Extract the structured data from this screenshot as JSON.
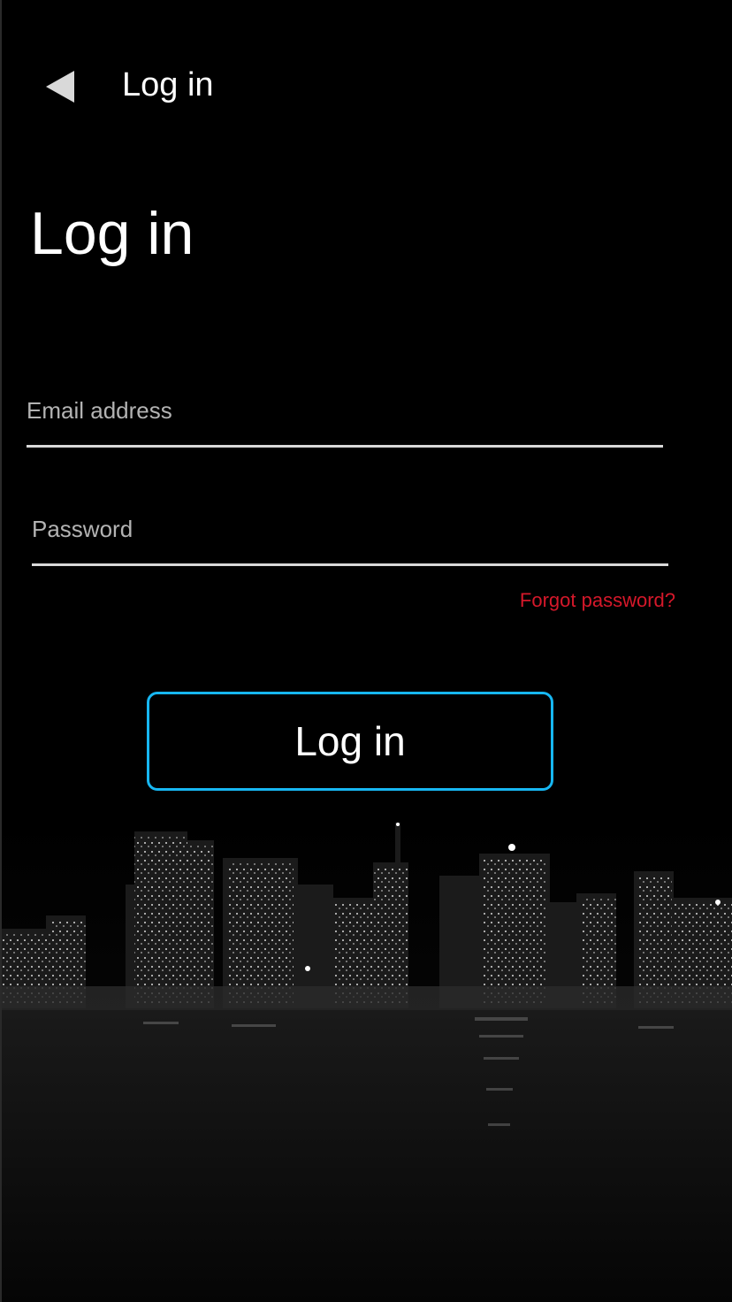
{
  "header": {
    "back_icon": "back-triangle-icon",
    "title": "Log in"
  },
  "page": {
    "title": "Log in"
  },
  "form": {
    "email_placeholder": "Email address",
    "email_value": "",
    "password_placeholder": "Password",
    "password_value": "",
    "forgot_label": "Forgot password?",
    "submit_label": "Log in"
  },
  "colors": {
    "background": "#000000",
    "accent_border": "#17b7f2",
    "forgot_link": "#d5182a",
    "text": "#ffffff",
    "placeholder": "#b3b3b3",
    "underline": "#d9d9d9"
  },
  "background_image": "night-city-skyline"
}
